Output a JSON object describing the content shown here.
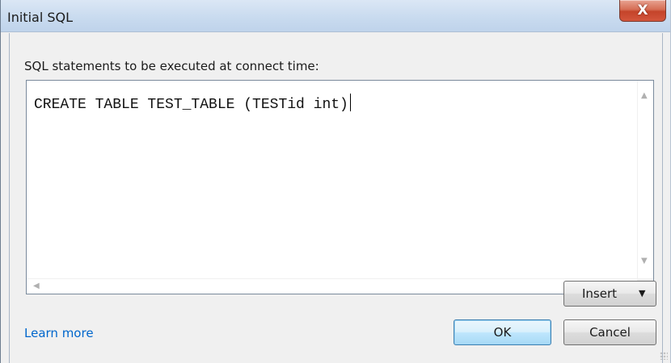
{
  "window": {
    "title": "Initial SQL",
    "close_glyph": "X"
  },
  "dialog": {
    "prompt": "SQL statements to be executed at connect time:",
    "sql_text": "CREATE TABLE TEST_TABLE (TESTid int)",
    "insert_label": "Insert",
    "dropdown_glyph": "▼",
    "ok_label": "OK",
    "cancel_label": "Cancel",
    "learn_more_label": "Learn more"
  },
  "scroll": {
    "up": "▲",
    "down": "▼",
    "left": "◀",
    "right": "▶"
  },
  "colors": {
    "link": "#0066cc",
    "default_button_border": "#3c7fb1",
    "close_button": "#c4442a"
  }
}
